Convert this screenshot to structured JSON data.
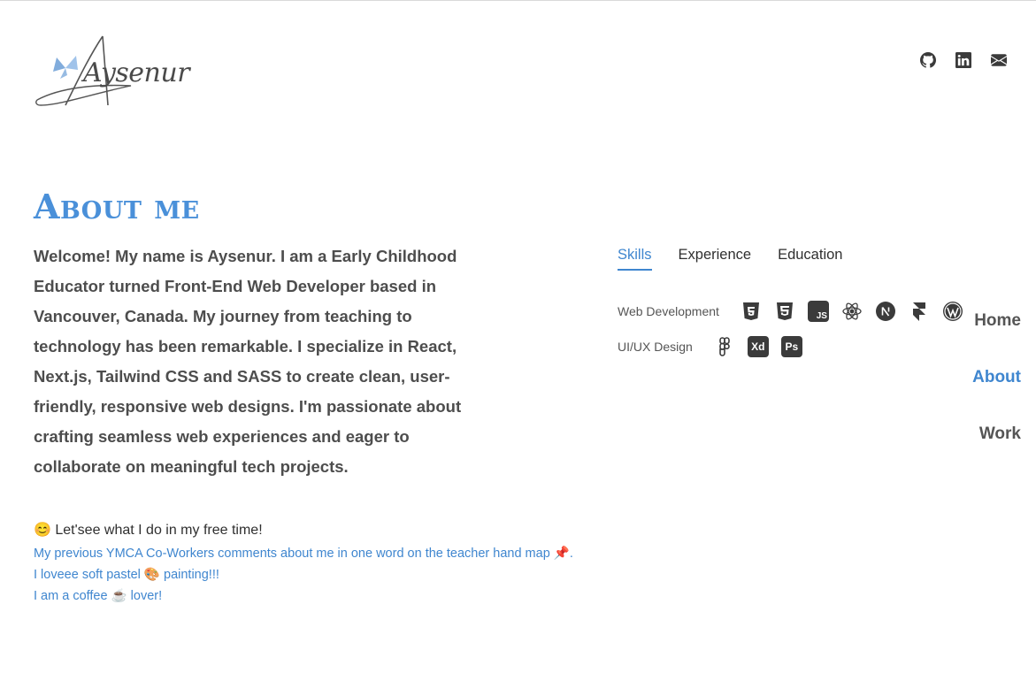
{
  "logo": {
    "text": "Aysenur"
  },
  "social": [
    {
      "icon": "github-icon"
    },
    {
      "icon": "linkedin-icon"
    },
    {
      "icon": "mail-icon"
    }
  ],
  "about": {
    "title": "About me",
    "intro": "Welcome! My name is Aysenur. I am a Early Childhood Educator turned Front-End Web Developer based in Vancouver, Canada. My journey from teaching to technology has been remarkable. I specialize in React, Next.js, Tailwind CSS and SASS to create clean, user-friendly, responsive web designs. I'm passionate about crafting seamless web experiences and eager to collaborate on meaningful tech projects."
  },
  "free_time": {
    "heading": "😊 Let'see what I do in my free time!",
    "links": [
      "My previous YMCA Co-Workers comments about me in one word on the teacher hand map 📌.",
      "I loveee soft pastel 🎨 painting!!!",
      "I am a coffee ☕ lover!"
    ]
  },
  "tabs": [
    "Skills",
    "Experience",
    "Education"
  ],
  "active_tab": "Skills",
  "skills": {
    "web_label": "Web Development",
    "web_icons": [
      "html5-icon",
      "css3-icon",
      "javascript-icon",
      "react-icon",
      "nextjs-icon",
      "framer-icon",
      "wordpress-icon"
    ],
    "js_badge": "JS",
    "ux_label": "UI/UX Design",
    "ux_icons": [
      "figma-icon",
      "adobe-xd-icon",
      "photoshop-icon"
    ],
    "xd_badge": "Xd",
    "ps_badge": "Ps"
  },
  "nav": [
    "Home",
    "About",
    "Work"
  ],
  "active_nav": "About",
  "colors": {
    "accent": "#3f86cf",
    "title": "#4a90d9",
    "text": "#4d4d4d",
    "logo_butterfly": "#6b9ed6"
  }
}
